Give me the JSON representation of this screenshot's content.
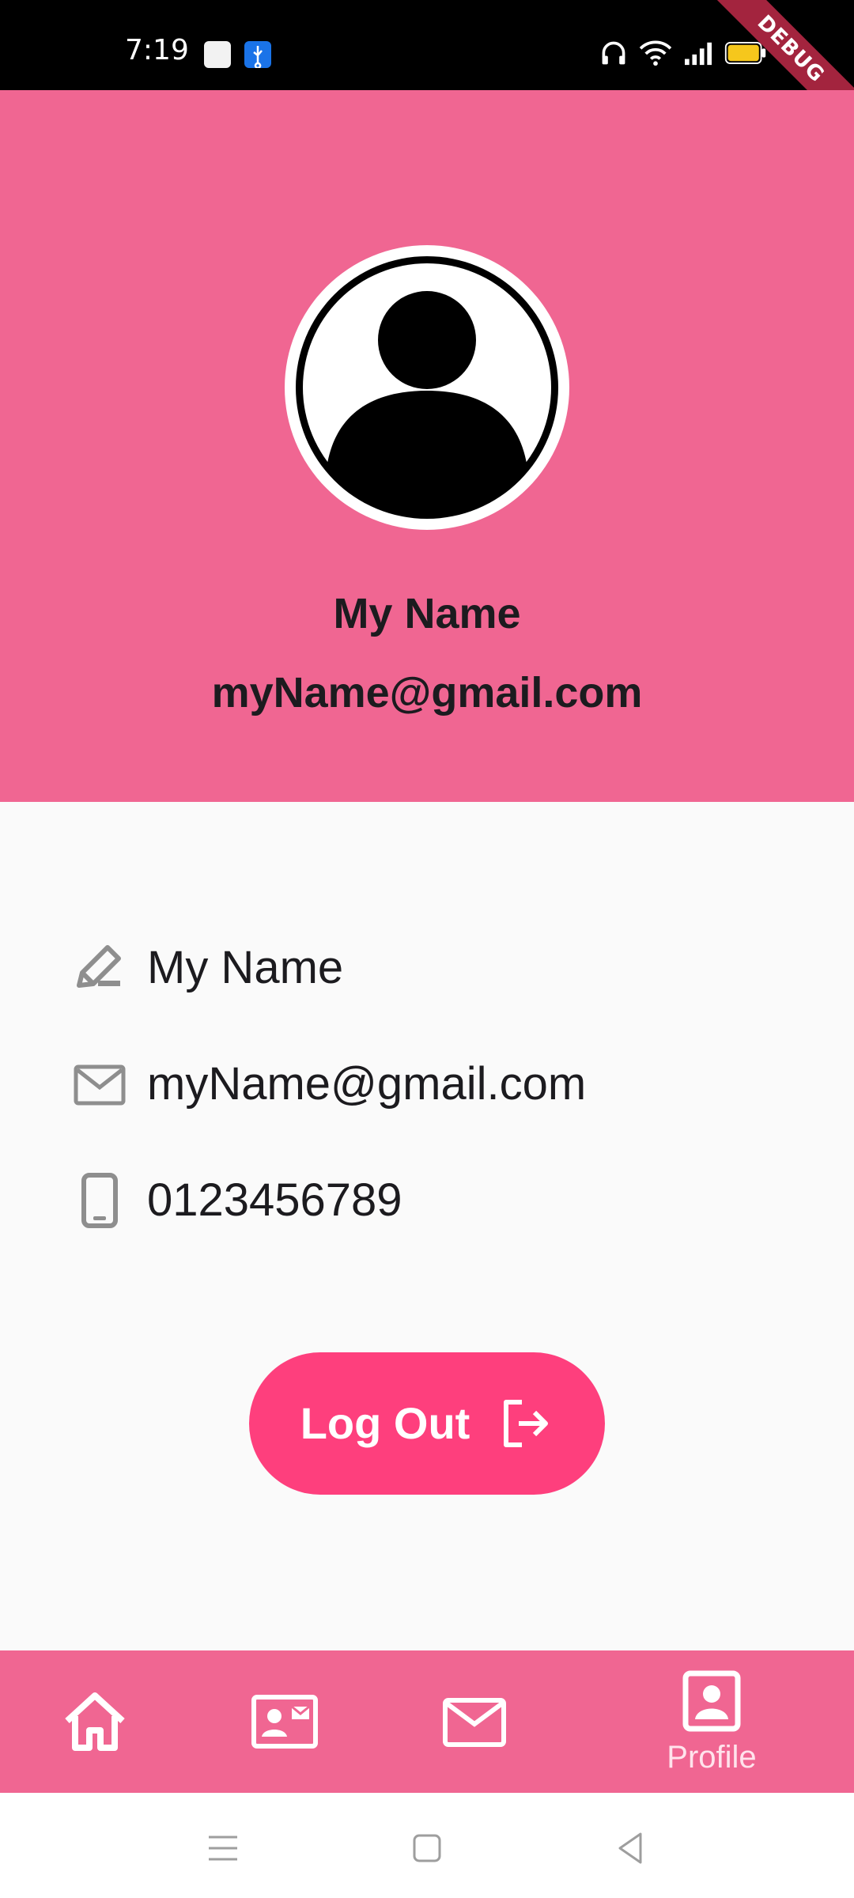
{
  "status_bar": {
    "time": "7:19",
    "debug_banner": "DEBUG"
  },
  "profile": {
    "name": "My Name",
    "email": "myName@gmail.com"
  },
  "details": [
    {
      "icon": "edit-pencil-icon",
      "value": "My Name"
    },
    {
      "icon": "mail-icon",
      "value": "myName@gmail.com"
    },
    {
      "icon": "phone-icon",
      "value": "0123456789"
    }
  ],
  "logout": {
    "label": "Log Out",
    "icon": "logout-icon"
  },
  "bottom_nav": {
    "items": [
      {
        "icon": "home-icon",
        "label": ""
      },
      {
        "icon": "contact-card-icon",
        "label": ""
      },
      {
        "icon": "mail-icon",
        "label": ""
      },
      {
        "icon": "profile-icon",
        "label": "Profile",
        "selected": true
      }
    ]
  },
  "colors": {
    "header": "#f06692",
    "button": "#fe3f7d",
    "page_background": "#fafafa",
    "text": "#1c1b1f",
    "icon_grey": "#8e8e8e"
  }
}
